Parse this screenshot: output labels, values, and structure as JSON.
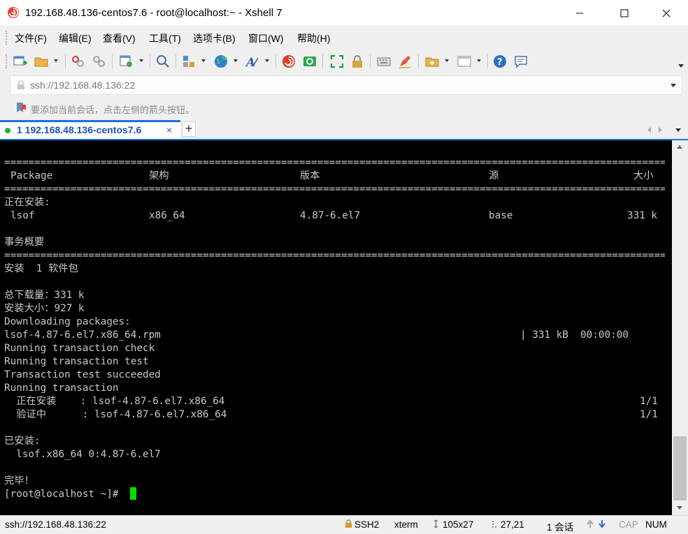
{
  "window": {
    "title": "192.168.48.136-centos7.6 - root@localhost:~ - Xshell 7"
  },
  "menu": [
    {
      "label": "文件(F)"
    },
    {
      "label": "编辑(E)"
    },
    {
      "label": "查看(V)"
    },
    {
      "label": "工具(T)"
    },
    {
      "label": "选项卡(B)"
    },
    {
      "label": "窗口(W)"
    },
    {
      "label": "帮助(H)"
    }
  ],
  "toolbar_icons": [
    "new-session-icon",
    "open-folder-icon",
    "disconnect-icon",
    "reconnect-icon",
    "properties-icon",
    "find-icon",
    "transfer-icon",
    "globe-icon",
    "font-icon",
    "xshell-icon",
    "xftp-icon",
    "fullscreen-icon",
    "lock-icon",
    "keyboard-icon",
    "highlight-icon",
    "new-tab-group-icon",
    "layout-icon",
    "help-icon",
    "chat-icon"
  ],
  "address": {
    "value": "ssh://192.168.48.136:22"
  },
  "hint": {
    "text": "要添加当前会话，点击左侧的箭头按钮。"
  },
  "tab": {
    "label": "1 192.168.48.136-centos7.6",
    "close": "×",
    "add": "+"
  },
  "terminal": {
    "separator": "================================================================================================================================================",
    "header": {
      "package": "Package",
      "arch": "架构",
      "version": "版本",
      "repo": "源",
      "size": "大小"
    },
    "section_installing": "正在安装:",
    "row": {
      "package": "lsof",
      "arch": "x86_64",
      "version": "4.87-6.el7",
      "repo": "base",
      "size": "331 k"
    },
    "summary_title": "事务概要",
    "install_count": "安装  1 软件包",
    "download_size": "总下载量：331 k",
    "installed_size": "安装大小：927 k",
    "downloading": "Downloading packages:",
    "rpm_file": "lsof-4.87-6.el7.x86_64.rpm",
    "rpm_progress": "| 331 kB  00:00:00",
    "check": "Running transaction check",
    "test": "Running transaction test",
    "test_ok": "Transaction test succeeded",
    "running": "Running transaction",
    "installing_line": "  正在安装    : lsof-4.87-6.el7.x86_64",
    "installing_count": "1/1",
    "verifying_line": "  验证中      : lsof-4.87-6.el7.x86_64",
    "verifying_count": "1/1",
    "installed_title": "已安装:",
    "installed_pkg": "  lsof.x86_64 0:4.87-6.el7",
    "done": "完毕！",
    "prompt": "[root@localhost ~]# "
  },
  "status": {
    "address": "ssh://192.168.48.136:22",
    "protocol": "SSH2",
    "term_type": "xterm",
    "size": "105x27",
    "cursor_pos": "27,21",
    "sessions": "1 会话",
    "cap": "CAP",
    "num": "NUM"
  },
  "colors": {
    "terminal_bg": "#000000",
    "terminal_fg": "#c8c8c8",
    "cursor": "#00e000",
    "tab_accent": "#1e6fd9",
    "tab_text": "#1a56b8"
  }
}
